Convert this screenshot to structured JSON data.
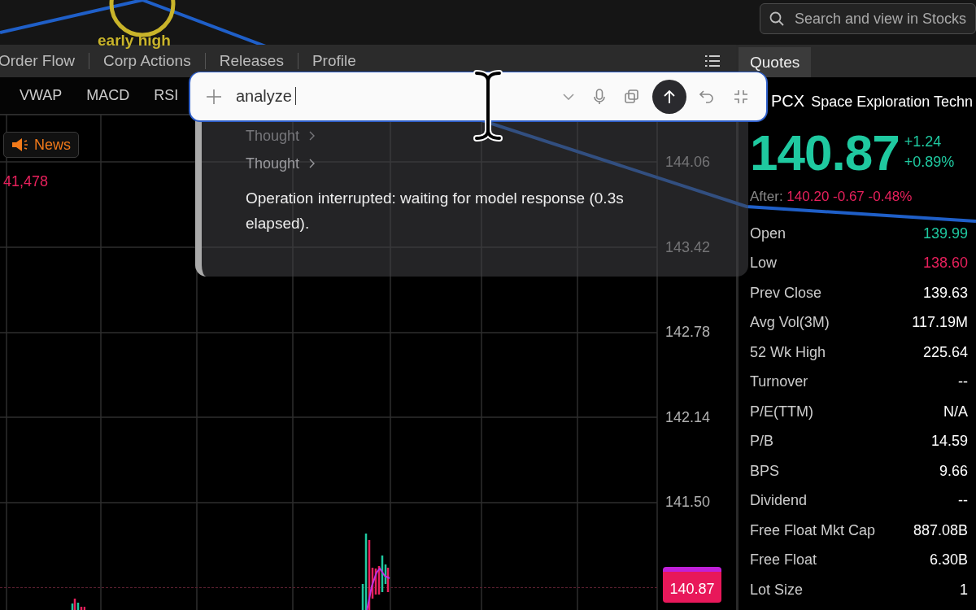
{
  "top_bar": {
    "search": {
      "placeholder": "Search and view in Stocks"
    }
  },
  "annotation": {
    "label": "early high"
  },
  "tabs": [
    "Order Flow",
    "Corp Actions",
    "Releases",
    "Profile"
  ],
  "indicators": [
    "VWAP",
    "MACD",
    "RSI"
  ],
  "chart": {
    "news_button": "News",
    "volume_reading": "41,478",
    "price_labels": [
      "144.06",
      "143.42",
      "142.78",
      "142.14",
      "141.50"
    ],
    "current_price": "140.87"
  },
  "assistant": {
    "input": {
      "value": "analyze"
    },
    "steps": [
      {
        "label": "Thought",
        "faded": true
      },
      {
        "label": "Thought",
        "faded": false
      }
    ],
    "message": "Operation interrupted: waiting for model response (0.3s elapsed)."
  },
  "quote_panel": {
    "tab": "Quotes",
    "symbol": "PCX",
    "name": "Space Exploration Techn",
    "price": "140.87",
    "change": "+1.24",
    "change_pct": "+0.89%",
    "after_label": "After:",
    "after_value": "140.20 -0.67 -0.48%",
    "rows": [
      {
        "label": "Open",
        "value": "139.99",
        "color": "#1fc9a0"
      },
      {
        "label": "Low",
        "value": "138.60",
        "color": "#e8205c"
      },
      {
        "label": "Prev Close",
        "value": "139.63",
        "color": "#ffffff"
      },
      {
        "label": "Avg Vol(3M)",
        "value": "117.19M",
        "color": "#ffffff"
      },
      {
        "label": "52 Wk High",
        "value": "225.64",
        "color": "#ffffff"
      },
      {
        "label": "Turnover",
        "value": "--",
        "color": "#ffffff"
      },
      {
        "label": "P/E(TTM)",
        "value": "N/A",
        "color": "#ffffff"
      },
      {
        "label": "P/B",
        "value": "14.59",
        "color": "#ffffff"
      },
      {
        "label": "BPS",
        "value": "9.66",
        "color": "#ffffff"
      },
      {
        "label": "Dividend",
        "value": "--",
        "color": "#ffffff"
      },
      {
        "label": "Free Float Mkt Cap",
        "value": "887.08B",
        "color": "#ffffff"
      },
      {
        "label": "Free Float",
        "value": "6.30B",
        "color": "#ffffff"
      },
      {
        "label": "Lot Size",
        "value": "1",
        "color": "#ffffff"
      }
    ]
  }
}
